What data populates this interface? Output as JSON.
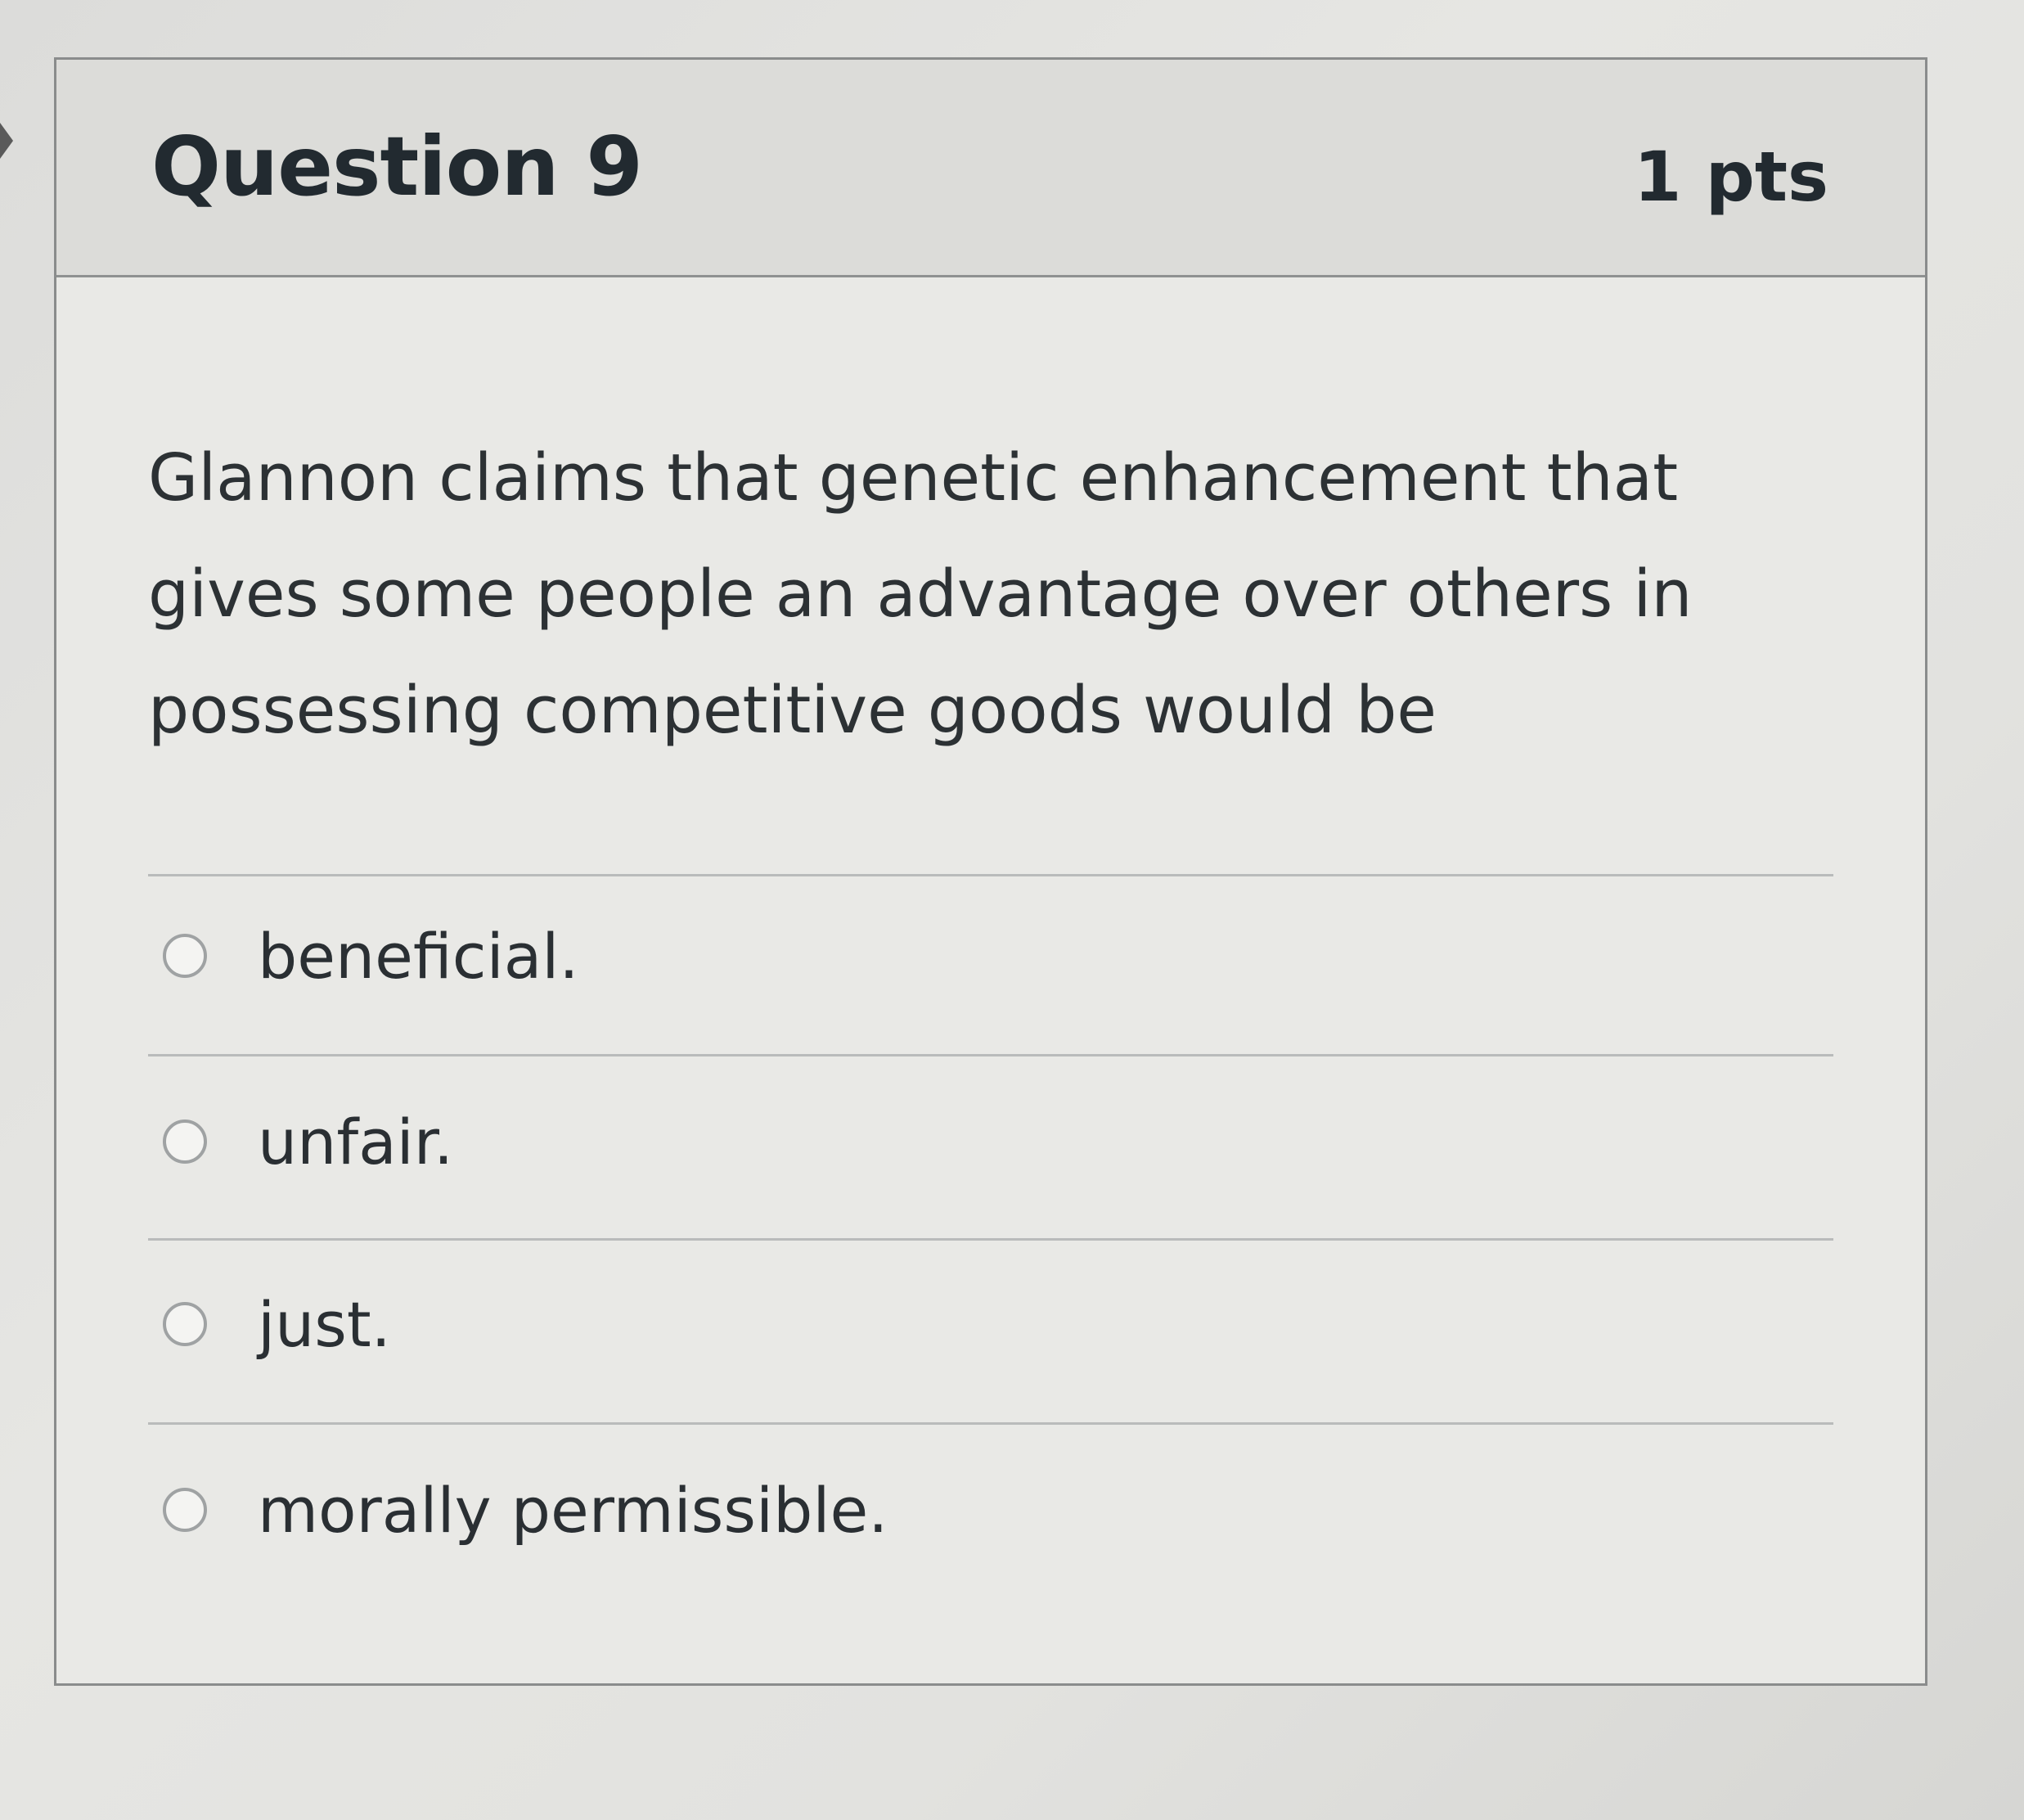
{
  "question": {
    "title": "Question 9",
    "points": "1 pts",
    "text": "Glannon claims that genetic enhancement that gives some people an advantage over others in possessing competitive goods would be"
  },
  "answers": [
    {
      "label": "beneficial."
    },
    {
      "label": "unfair."
    },
    {
      "label": "just."
    },
    {
      "label": "morally permissible."
    }
  ]
}
